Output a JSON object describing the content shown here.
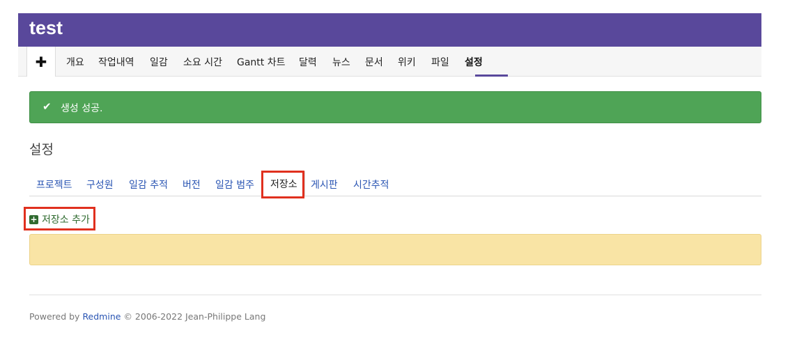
{
  "header": {
    "title": "test",
    "bg_color": "#59489b"
  },
  "main_menu": {
    "new_icon": "plus-icon",
    "tabs": [
      {
        "label": "개요"
      },
      {
        "label": "작업내역"
      },
      {
        "label": "일감"
      },
      {
        "label": "소요 시간"
      },
      {
        "label": "Gantt 차트"
      },
      {
        "label": "달력"
      },
      {
        "label": "뉴스"
      },
      {
        "label": "문서"
      },
      {
        "label": "위키"
      },
      {
        "label": "파일"
      },
      {
        "label": "설정",
        "selected": true
      }
    ]
  },
  "flash": {
    "icon": "check-icon",
    "message": "생성 성공.",
    "color": "#4fa456"
  },
  "page_title": "설정",
  "settings_tabs": [
    {
      "label": "프로젝트"
    },
    {
      "label": "구성원"
    },
    {
      "label": "일감 추적"
    },
    {
      "label": "버전"
    },
    {
      "label": "일감 범주"
    },
    {
      "label": "저장소",
      "selected": true
    },
    {
      "label": "게시판"
    },
    {
      "label": "시간추적"
    }
  ],
  "add_repository": {
    "icon": "add-icon",
    "label": "저장소 추가"
  },
  "warning_box": {
    "color": "#f9e4a5"
  },
  "footer": {
    "prefix": "Powered by",
    "link": "Redmine",
    "suffix": "© 2006-2022 Jean-Philippe Lang"
  },
  "highlight_color": "#e0301e"
}
